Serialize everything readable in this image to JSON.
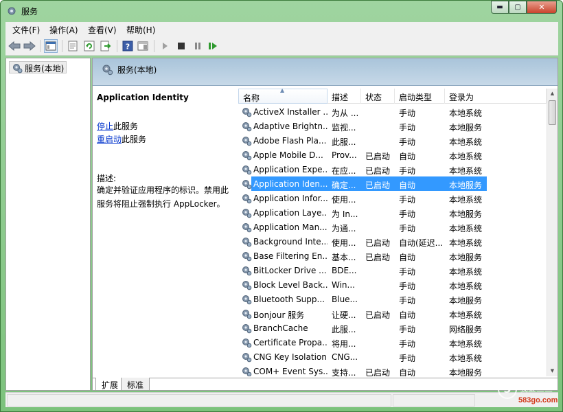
{
  "window": {
    "title": "服务",
    "minimize": "▬",
    "maximize": "▢",
    "close": "✕"
  },
  "menu": [
    "文件(F)",
    "操作(A)",
    "查看(V)",
    "帮助(H)"
  ],
  "toolbar": [
    "back-icon",
    "forward-icon",
    "show-hide-tree-icon",
    "properties-icon",
    "refresh-icon",
    "export-list-icon",
    "help-icon",
    "show-action-pane-icon",
    "start-service-icon",
    "stop-service-icon",
    "pause-service-icon",
    "restart-service-icon"
  ],
  "tree": {
    "root": "服务(本地)"
  },
  "header": {
    "title": "服务(本地)"
  },
  "details": {
    "service_name": "Application Identity",
    "stop_link": "停止",
    "stop_suffix": "此服务",
    "restart_link": "重启动",
    "restart_suffix": "此服务",
    "desc_label": "描述:",
    "desc_text": "确定并验证应用程序的标识。禁用此服务将阻止强制执行 AppLocker。"
  },
  "columns": [
    "名称",
    "描述",
    "状态",
    "启动类型",
    "登录为"
  ],
  "rows": [
    {
      "name": "ActiveX Installer ...",
      "desc": "为从 ...",
      "status": "",
      "startup": "手动",
      "logon": "本地系统"
    },
    {
      "name": "Adaptive Brightn...",
      "desc": "监视...",
      "status": "",
      "startup": "手动",
      "logon": "本地服务"
    },
    {
      "name": "Adobe Flash Pla...",
      "desc": "此服...",
      "status": "",
      "startup": "手动",
      "logon": "本地系统"
    },
    {
      "name": "Apple Mobile D...",
      "desc": "Prov...",
      "status": "已启动",
      "startup": "自动",
      "logon": "本地系统"
    },
    {
      "name": "Application Expe...",
      "desc": "在应...",
      "status": "已启动",
      "startup": "手动",
      "logon": "本地系统"
    },
    {
      "name": "Application Iden...",
      "desc": "确定...",
      "status": "已启动",
      "startup": "自动",
      "logon": "本地服务",
      "selected": true
    },
    {
      "name": "Application Infor...",
      "desc": "使用...",
      "status": "",
      "startup": "手动",
      "logon": "本地系统"
    },
    {
      "name": "Application Laye...",
      "desc": "为 In...",
      "status": "",
      "startup": "手动",
      "logon": "本地服务"
    },
    {
      "name": "Application Man...",
      "desc": "为通...",
      "status": "",
      "startup": "手动",
      "logon": "本地系统"
    },
    {
      "name": "Background Inte...",
      "desc": "使用...",
      "status": "已启动",
      "startup": "自动(延迟...",
      "logon": "本地系统"
    },
    {
      "name": "Base Filtering En...",
      "desc": "基本...",
      "status": "已启动",
      "startup": "自动",
      "logon": "本地服务"
    },
    {
      "name": "BitLocker Drive ...",
      "desc": "BDE...",
      "status": "",
      "startup": "手动",
      "logon": "本地系统"
    },
    {
      "name": "Block Level Back...",
      "desc": "Win...",
      "status": "",
      "startup": "手动",
      "logon": "本地系统"
    },
    {
      "name": "Bluetooth Supp...",
      "desc": "Blue...",
      "status": "",
      "startup": "手动",
      "logon": "本地服务"
    },
    {
      "name": "Bonjour 服务",
      "desc": "让硬...",
      "status": "已启动",
      "startup": "自动",
      "logon": "本地系统"
    },
    {
      "name": "BranchCache",
      "desc": "此服...",
      "status": "",
      "startup": "手动",
      "logon": "网络服务"
    },
    {
      "name": "Certificate Propa...",
      "desc": "将用...",
      "status": "",
      "startup": "手动",
      "logon": "本地系统"
    },
    {
      "name": "CNG Key Isolation",
      "desc": "CNG...",
      "status": "",
      "startup": "手动",
      "logon": "本地系统"
    },
    {
      "name": "COM+ Event Sys...",
      "desc": "支持...",
      "status": "已启动",
      "startup": "自动",
      "logon": "本地服务"
    }
  ],
  "tabs": [
    "扩展",
    "标准"
  ],
  "watermark": {
    "logo": "5",
    "text": "我爱三三",
    "url": "583go.com"
  }
}
